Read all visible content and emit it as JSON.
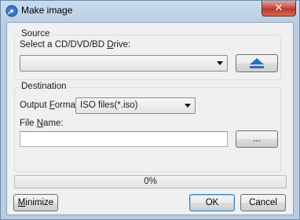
{
  "window": {
    "title": "Make image",
    "close_glyph": "✕"
  },
  "source": {
    "group_title": "Source",
    "drive_label_pre": "Select a CD/DVD/BD ",
    "drive_label_key": "D",
    "drive_label_post": "rive:",
    "drive_value": "",
    "eject_icon": "eject-icon"
  },
  "destination": {
    "group_title": "Destination",
    "format_label_pre": "Output ",
    "format_label_key": "F",
    "format_label_post": "ormat:",
    "format_value": "ISO files(*.iso)",
    "filename_label_pre": "File ",
    "filename_label_key": "N",
    "filename_label_post": "ame:",
    "filename_value": "",
    "browse_label": "..."
  },
  "progress": {
    "percent": 0,
    "text": "0%",
    "fill_color": "#37b837"
  },
  "buttons": {
    "minimize_key": "M",
    "minimize_rest": "inimize",
    "ok": "OK",
    "cancel": "Cancel"
  },
  "colors": {
    "eject_icon": "#2f6fc0",
    "close_button": "#c75050"
  }
}
